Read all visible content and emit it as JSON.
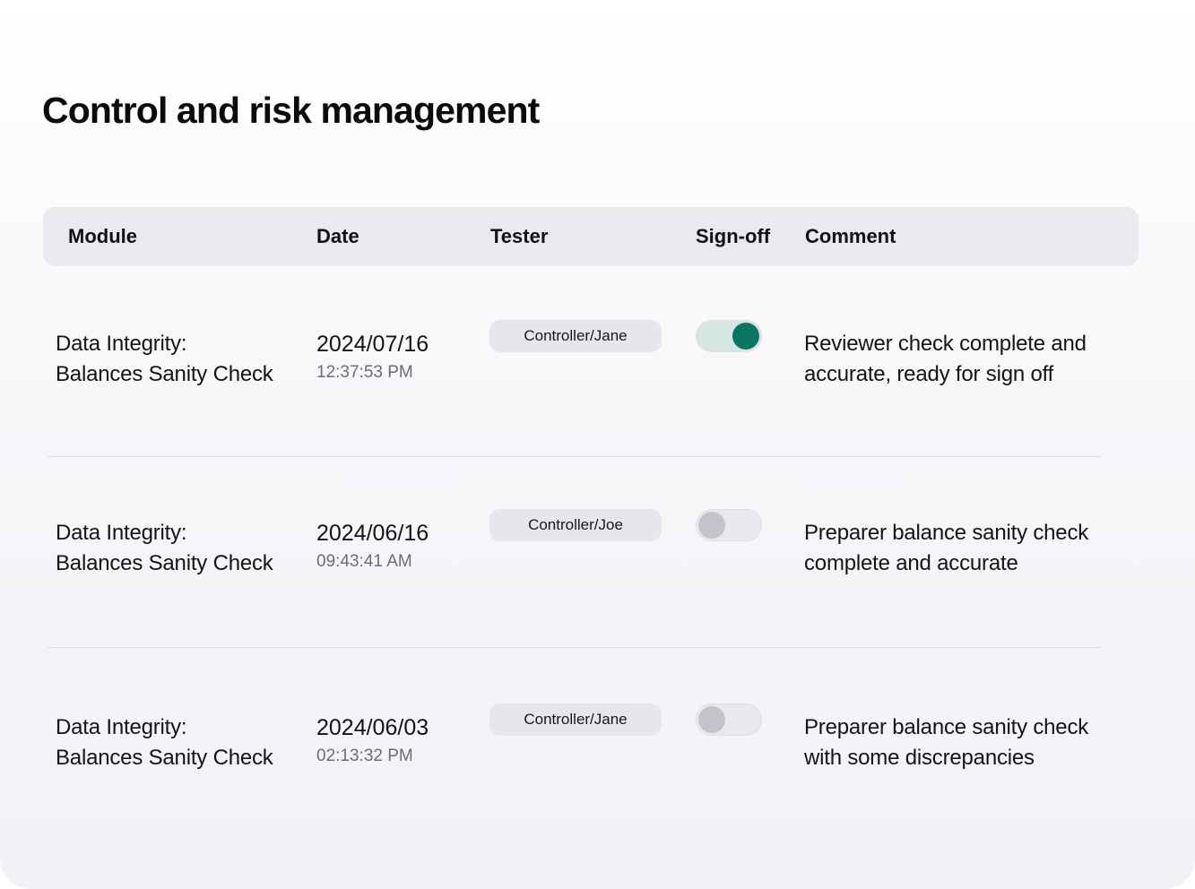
{
  "page": {
    "title": "Control and risk management"
  },
  "table": {
    "columns": {
      "module": "Module",
      "date": "Date",
      "tester": "Tester",
      "signoff": "Sign-off",
      "comment": "Comment"
    },
    "rows": [
      {
        "module_line1": "Data Integrity:",
        "module_line2": "Balances Sanity Check",
        "date": "2024/07/16",
        "time": "12:37:53 PM",
        "tester": "Controller/Jane",
        "signed_off": true,
        "comment_line1": "Reviewer check complete and",
        "comment_line2": "accurate, ready for sign off"
      },
      {
        "module_line1": "Data Integrity:",
        "module_line2": "Balances Sanity Check",
        "date": "2024/06/16",
        "time": "09:43:41 AM",
        "tester": "Controller/Joe",
        "signed_off": false,
        "comment_line1": "Preparer balance sanity check",
        "comment_line2": "complete and accurate"
      },
      {
        "module_line1": "Data Integrity:",
        "module_line2": "Balances Sanity Check",
        "date": "2024/06/03",
        "time": "02:13:32 PM",
        "tester": "Controller/Jane",
        "signed_off": false,
        "comment_line1": "Preparer balance sanity check",
        "comment_line2": "with some discrepancies"
      }
    ]
  },
  "colors": {
    "toggle_on": "#0c7561",
    "toggle_on_track": "#d6e4e2",
    "toggle_off_knob": "#c3c4cb",
    "header_bg": "#e9e9ee"
  }
}
